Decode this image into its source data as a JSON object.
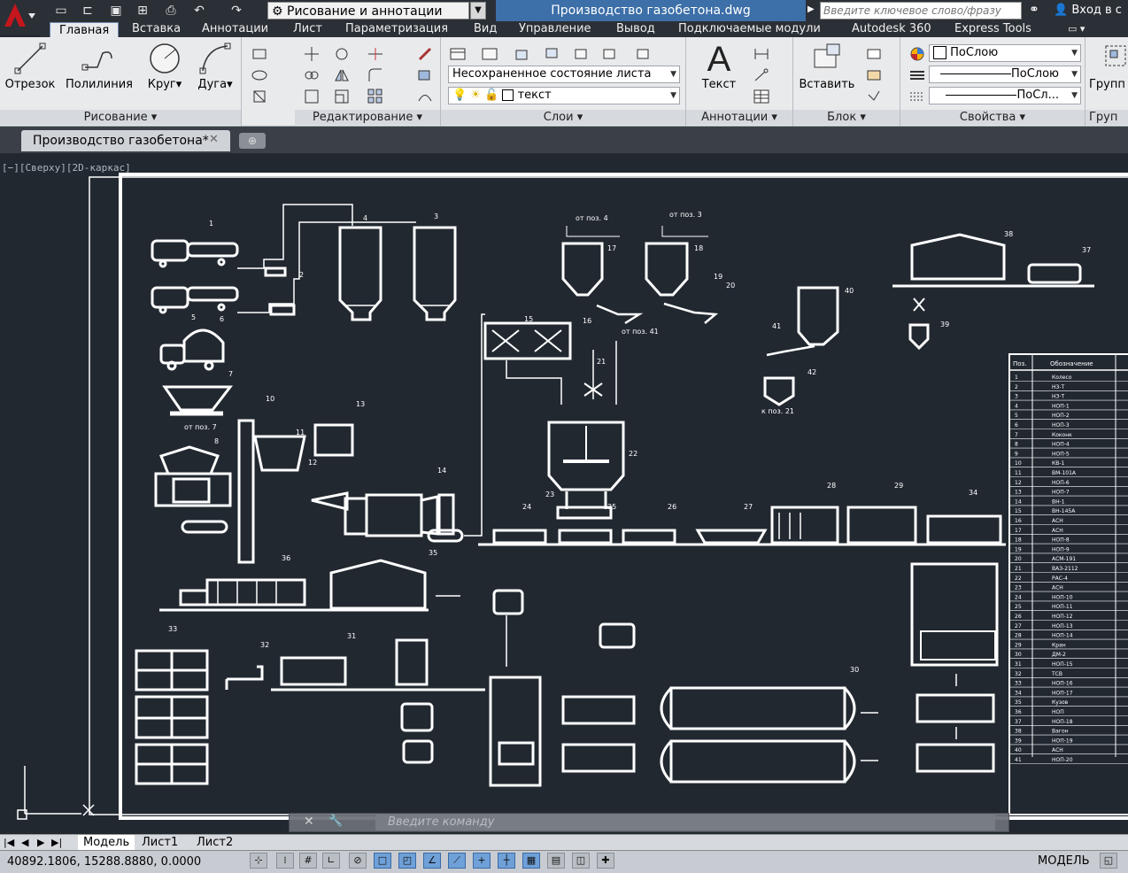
{
  "titlebar": {
    "workspace": "Рисование и аннотации",
    "doc_title": "Производство газобетона.dwg",
    "search_placeholder": "Введите ключевое слово/фразу",
    "login": "Вход в с"
  },
  "tabs": [
    "Главная",
    "Вставка",
    "Аннотации",
    "Лист",
    "Параметризация",
    "Вид",
    "Управление",
    "Вывод",
    "Подключаемые модули",
    "Autodesk 360",
    "Express Tools"
  ],
  "ribbon": {
    "draw": {
      "title": "Рисование",
      "line": "Отрезок",
      "polyline": "Полилиния",
      "circle": "Круг",
      "arc": "Дуга"
    },
    "modify": {
      "title": "Редактирование"
    },
    "layers": {
      "title": "Слои",
      "layer_state": "Несохраненное состояние листа",
      "current_layer": "текст"
    },
    "annotation": {
      "title": "Аннотации",
      "text": "Текст"
    },
    "block": {
      "title": "Блок",
      "insert": "Вставить"
    },
    "properties": {
      "title": "Свойства",
      "color": "ПоСлою",
      "linetype": "ПоСлою",
      "lineweight": "ПоСл..."
    },
    "groups": {
      "title": "Груп",
      "group": "Групп"
    }
  },
  "file_tab": "Производство газобетона*",
  "viewport_label": "[−][Сверху][2D-каркас]",
  "drawing": {
    "callouts": {
      "c1": "1",
      "c2": "2",
      "c3": "3",
      "c4": "4",
      "c5": "5",
      "c6": "6",
      "c7": "7",
      "c8": "8",
      "c10": "10",
      "c11": "11",
      "c12": "12",
      "c13": "13",
      "c14": "14",
      "c15": "15",
      "c16": "16",
      "c17": "17",
      "c18": "18",
      "c19": "19",
      "c20": "20",
      "c21": "21",
      "c22": "22",
      "c23": "23",
      "c24": "24",
      "c25": "25",
      "c26": "26",
      "c27": "27",
      "c28": "28",
      "c29": "29",
      "c30": "30",
      "c32": "32",
      "c33": "33",
      "c34": "34",
      "c35": "35",
      "c36": "36",
      "c37": "37",
      "c38": "38",
      "c39": "39",
      "c40": "40",
      "c41": "41",
      "c42": "42",
      "c31": "31"
    },
    "notes": {
      "from4": "от поз. 4",
      "from3": "от поз. 3",
      "from41": "от поз. 41",
      "from7": "от поз. 7",
      "to21": "к поз. 21"
    }
  },
  "spec_table": {
    "headers": [
      "Поз.",
      "Обозначение"
    ],
    "rows": [
      "Колесо",
      "НЗ-Т",
      "НЗ-Т",
      "НОП-1",
      "НОП-2",
      "НОП-3",
      "Коконк",
      "НОП-4",
      "НОП-5",
      "КВ-1",
      "ВМ-101А",
      "НОП-6",
      "НОП-7",
      "ВН-1",
      "ВН-145А",
      "АСН",
      "АСН",
      "НОП-8",
      "НОП-9",
      "АСМ-191",
      "ВАЗ-2112",
      "РАС-4",
      "АСН",
      "НОП-10",
      "НОП-11",
      "НОП-12",
      "НОП-13",
      "НОП-14",
      "Кран",
      "ДМ-2",
      "НОП-15",
      "ТСВ",
      "НОП-16",
      "НОП-17",
      "Кузов",
      "НОП",
      "НОП-18",
      "Вагон",
      "НОП-19",
      "АСН",
      "НОП-20"
    ]
  },
  "command": {
    "placeholder": "Введите команду"
  },
  "layout_tabs": [
    "Модель",
    "Лист1",
    "Лист2"
  ],
  "status": {
    "coords": "40892.1806, 15288.8880, 0.0000",
    "space": "МОДЕЛЬ"
  }
}
